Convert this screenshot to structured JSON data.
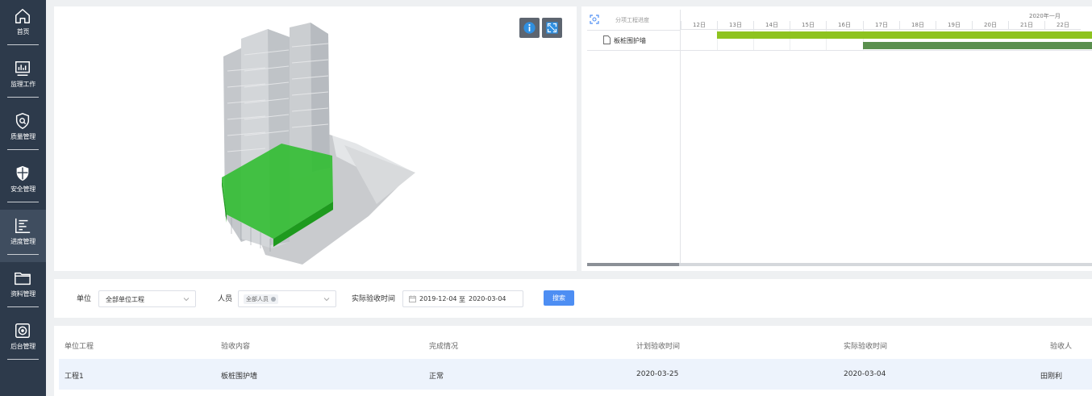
{
  "sidebar": {
    "items": [
      {
        "label": "首页",
        "icon": "home-icon"
      },
      {
        "label": "监理工作",
        "icon": "chart-monitor-icon"
      },
      {
        "label": "质量管理",
        "icon": "shield-search-icon"
      },
      {
        "label": "安全管理",
        "icon": "shield-icon"
      },
      {
        "label": "进度管理",
        "icon": "bar-chart-icon",
        "active": true
      },
      {
        "label": "资料管理",
        "icon": "folder-icon"
      },
      {
        "label": "后台管理",
        "icon": "settings-icon"
      }
    ]
  },
  "model_viewer": {
    "buttons": [
      "info-icon",
      "fullscreen-icon"
    ]
  },
  "gantt": {
    "header_title": "分项工程进度",
    "month_label": "2020年一月",
    "days": [
      "12日",
      "13日",
      "14日",
      "15日",
      "16日",
      "17日",
      "18日",
      "19日",
      "20日",
      "21日",
      "22日"
    ],
    "tasks": [
      {
        "name": "板桩围护墙"
      }
    ],
    "colors": {
      "plan_bar": "#8ec31f",
      "actual_bar": "#5a8f4e"
    }
  },
  "filter": {
    "unit_label": "单位",
    "unit_value": "全部单位工程",
    "person_label": "人员",
    "person_tag": "全部人员",
    "date_label": "实际验收时间",
    "date_start": "2019-12-04",
    "date_separator": "至",
    "date_end": "2020-03-04",
    "search_label": "搜索",
    "accent": "#4d8ef3"
  },
  "table": {
    "columns": [
      "单位工程",
      "验收内容",
      "完成情况",
      "计划验收时间",
      "实际验收时间",
      "验收人"
    ],
    "rows": [
      [
        "工程1",
        "板桩围护墙",
        "正常",
        "2020-03-25",
        "2020-03-04",
        "田刚利"
      ]
    ]
  }
}
